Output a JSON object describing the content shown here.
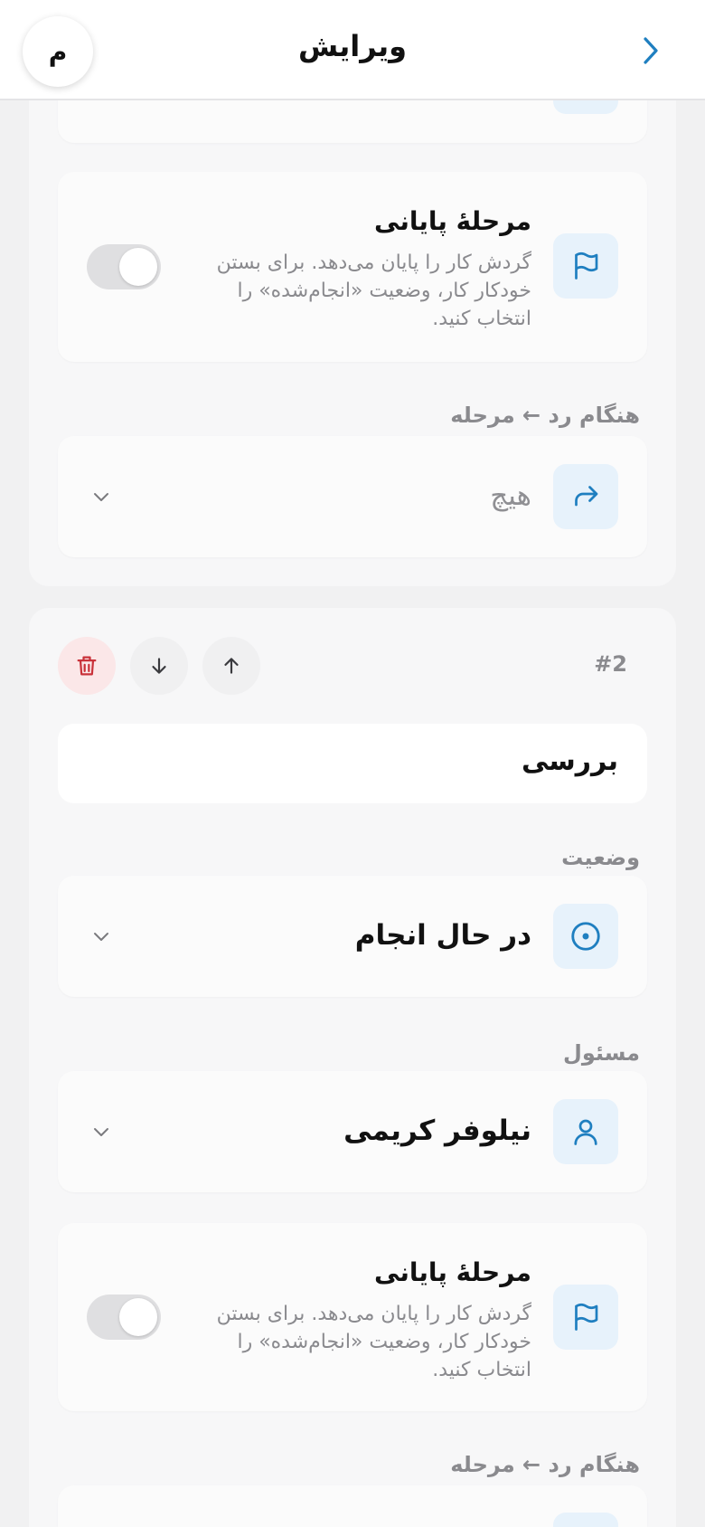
{
  "header": {
    "title": "ویرایش",
    "avatar_initial": "م"
  },
  "colors": {
    "accent": "#1f7fc0",
    "icon_bg": "#e7f2fb",
    "danger": "#c9323a",
    "muted_text": "#8a8a8e"
  },
  "step1": {
    "final_step": {
      "title": "مرحلهٔ پایانی",
      "description": "گردش کار را پایان می‌دهد. برای بستن خودکار کار، وضعیت «انجام‌شده» را انتخاب کنید.",
      "icon": "flag-icon",
      "enabled": false
    },
    "reject": {
      "label": "هنگام رد ← مرحله",
      "value": "هیچ",
      "icon": "redo-arrow-icon"
    }
  },
  "step2": {
    "number": "#2",
    "actions": {
      "move_up_icon": "arrow-up-icon",
      "move_down_icon": "arrow-down-icon",
      "delete_icon": "trash-icon"
    },
    "name": "بررسی",
    "status": {
      "label": "وضعیت",
      "value": "در حال انجام",
      "icon": "target-circle-icon"
    },
    "assignee": {
      "label": "مسئول",
      "value": "نیلوفر کریمی",
      "icon": "user-icon"
    },
    "final_step": {
      "title": "مرحلهٔ پایانی",
      "description": "گردش کار را پایان می‌دهد. برای بستن خودکار کار، وضعیت «انجام‌شده» را انتخاب کنید.",
      "icon": "flag-icon",
      "enabled": false
    },
    "reject": {
      "label": "هنگام رد ← مرحله"
    }
  }
}
